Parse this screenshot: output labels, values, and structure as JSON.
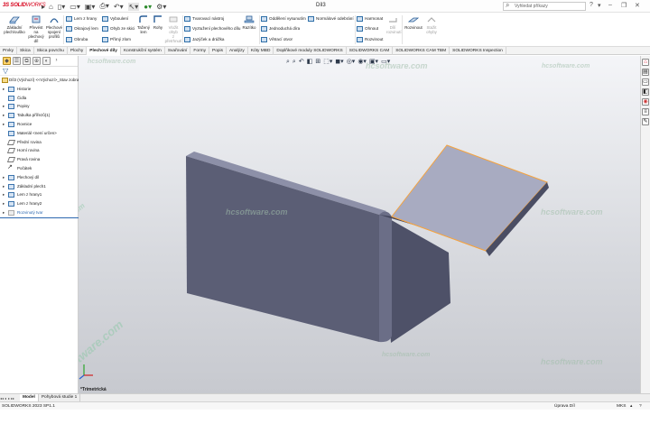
{
  "app": {
    "logo_bold": "3S SOLID",
    "logo_thin": "WORKS",
    "document_title": "Díl3",
    "search_placeholder": "Vyhledat příkazy"
  },
  "ribbon": {
    "big_buttons": [
      {
        "label": "Základní\nplech/ouško",
        "icon": "base-flange-icon"
      },
      {
        "label": "Převést\nna\nplechový\ndíl",
        "icon": "convert-to-sheet-metal-icon"
      },
      {
        "label": "Plechové\nspojení\nprofilů",
        "icon": "lofted-bend-icon"
      },
      {
        "label": "Tažený\nlem",
        "icon": "swept-flange-icon"
      },
      {
        "label": "Rohy",
        "icon": "corners-icon"
      },
      {
        "label": "Vložit ohyb\nz\npřetrhnutí",
        "icon": "insert-bends-icon",
        "disabled": true
      },
      {
        "label": "Razítko",
        "icon": "stamp-icon"
      },
      {
        "label": "Dílí\nrozvinutí",
        "icon": "unfold-icon",
        "disabled": true
      },
      {
        "label": "Rozvinout",
        "icon": "flatten-icon"
      },
      {
        "label": "Stažit\nohyby",
        "icon": "no-bends-icon",
        "disabled": true
      }
    ],
    "small_buttons": [
      {
        "label": "Lem z hrany",
        "icon": "edge-flange-icon"
      },
      {
        "label": "Okrajový lem",
        "icon": "miter-flange-icon"
      },
      {
        "label": "Obruba",
        "icon": "hem-icon"
      },
      {
        "label": "Vyboulení",
        "icon": "jog-icon"
      },
      {
        "label": "Ohyb ze skici",
        "icon": "sketched-bend-icon"
      },
      {
        "label": "Přímý zlom",
        "icon": "cross-break-icon"
      },
      {
        "label": "Tvarovací nástroj",
        "icon": "forming-tool-icon"
      },
      {
        "label": "Vyztužení plechového dílu",
        "icon": "gusset-icon"
      },
      {
        "label": "Jazýček a drážka",
        "icon": "tab-slot-icon"
      },
      {
        "label": "Oddělení vysunutím",
        "icon": "extruded-cut-icon"
      },
      {
        "label": "Jednoduchá díra",
        "icon": "simple-hole-icon"
      },
      {
        "label": "Větrací otvor",
        "icon": "vent-icon"
      },
      {
        "label": "Normálové odebrání",
        "icon": "normal-cut-icon"
      },
      {
        "label": "Harmonat",
        "icon": "rip-icon"
      },
      {
        "label": "Ohnout",
        "icon": "fold-icon"
      },
      {
        "label": "Rozvinout",
        "icon": "unfold-small-icon"
      }
    ]
  },
  "tabs": [
    "Prvky",
    "Skica",
    "Skica povrchu",
    "Plochy",
    "Plechové díly",
    "Konstrukční systém",
    "Svařování",
    "Formy",
    "Popis",
    "Analýzy",
    "Kóty MBD",
    "Doplňkové moduly SOLIDWORKS",
    "SOLIDWORKS CAM",
    "SOLIDWORKS CAM TBM",
    "SOLIDWORKS Inspection"
  ],
  "active_tab": "Plechové díly",
  "feature_tree": {
    "root": "Díl3 (Výchozí) <<Výchozí>_Stav zobraz",
    "items": [
      {
        "label": "Historie",
        "expand": "▸",
        "kind": "folder"
      },
      {
        "label": "Čidla",
        "expand": "",
        "kind": "sensor"
      },
      {
        "label": "Popisy",
        "expand": "▸",
        "kind": "annotations"
      },
      {
        "label": "Tabulka přířezů(1)",
        "expand": "▸",
        "kind": "cutlist"
      },
      {
        "label": "Rovnice",
        "expand": "▸",
        "kind": "equations"
      },
      {
        "label": "Materiál <není určen>",
        "expand": "",
        "kind": "material"
      },
      {
        "label": "Přední rovina",
        "expand": "",
        "kind": "plane"
      },
      {
        "label": "Horní rovina",
        "expand": "",
        "kind": "plane"
      },
      {
        "label": "Pravá rovina",
        "expand": "",
        "kind": "plane"
      },
      {
        "label": "Počátek",
        "expand": "",
        "kind": "origin"
      },
      {
        "label": "Plechový díl",
        "expand": "▸",
        "kind": "sheetmetal"
      },
      {
        "label": "Základní plech1",
        "expand": "▸",
        "kind": "baseflange"
      },
      {
        "label": "Lem z hrany1",
        "expand": "▸",
        "kind": "edgeflange"
      },
      {
        "label": "Lem z hrany2",
        "expand": "▸",
        "kind": "edgeflange"
      },
      {
        "label": "Rozvinutý tvar",
        "expand": "▸",
        "kind": "flatpattern",
        "selected": true
      }
    ]
  },
  "viewport": {
    "view_label": "*Trimetrická",
    "watermarks": [
      "hcsoftware.com",
      "hcsoftware.com",
      "hcsoftware.com",
      "hcsoftware.com",
      "hcsoftware.com",
      "hcsoftware.com",
      "hcsoftware.com",
      "hcsoftware.com",
      "hcsoftware.com"
    ],
    "part_color": "#5b5e75",
    "highlight_color": "#f4a340"
  },
  "bottom_tabs": [
    "Model",
    "Pohybová studie 1"
  ],
  "active_bottom_tab": "Model",
  "status": {
    "version": "SOLIDWORKS 2023 SP1.1",
    "mode": "Úprava Díl",
    "units": "MKS"
  }
}
